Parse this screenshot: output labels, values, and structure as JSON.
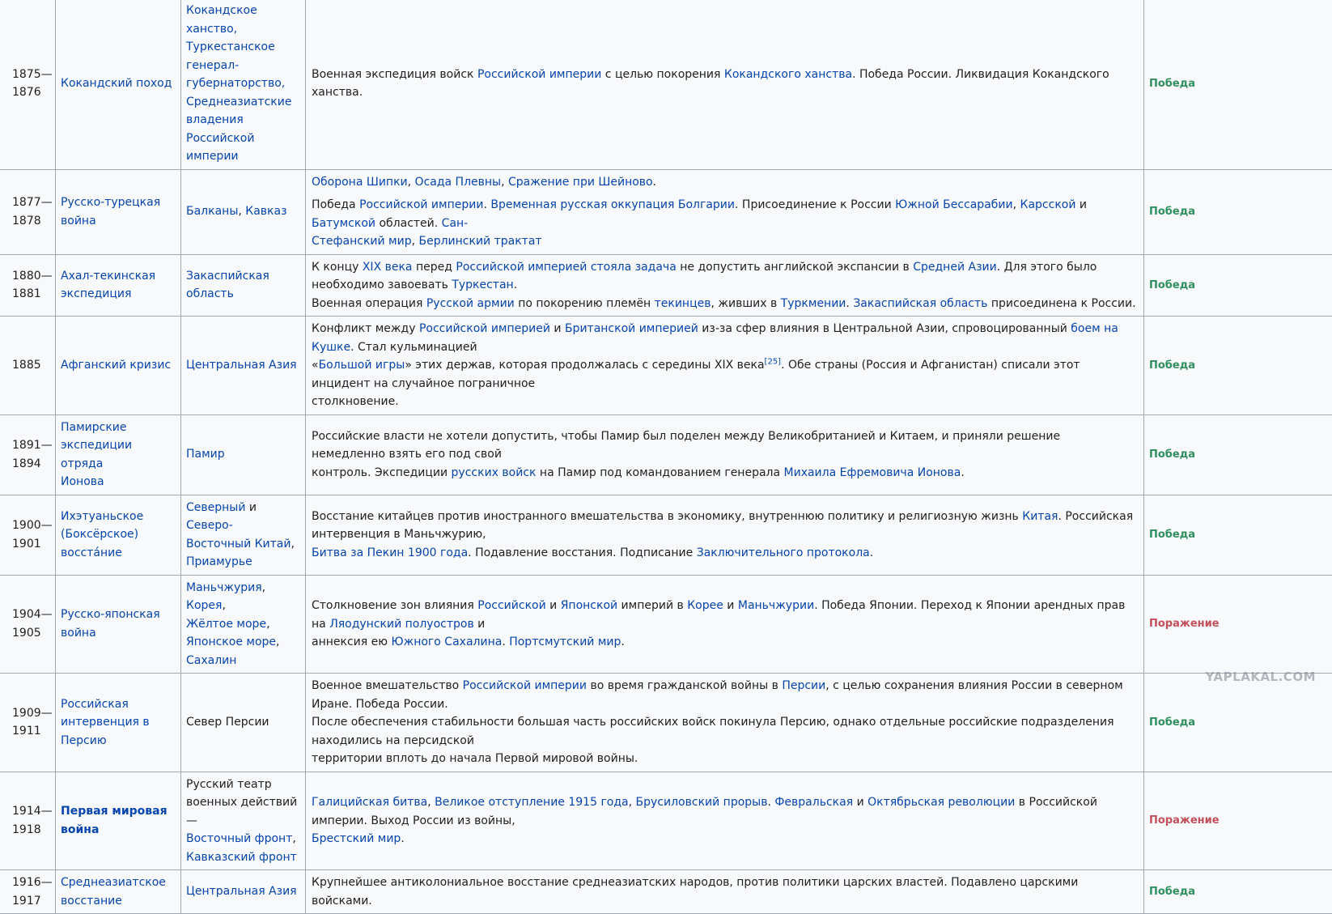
{
  "rows": [
    {
      "years": [
        "1875—",
        "1876"
      ],
      "name": [
        {
          "t": "Кокандский поход",
          "l": true
        }
      ],
      "place": [
        [
          {
            "t": "Кокандское ханство,",
            "l": true
          }
        ],
        [
          {
            "t": "Туркестанское",
            "l": true
          }
        ],
        [
          {
            "t": "генерал-",
            "l": true
          }
        ],
        [
          {
            "t": "губернаторство,",
            "l": true
          }
        ],
        [
          {
            "t": "Среднеазиатские",
            "l": true
          }
        ],
        [
          {
            "t": "владения ",
            "l": true
          },
          {
            "t": "Российской",
            "l": true
          }
        ],
        [
          {
            "t": "империи",
            "l": true
          }
        ]
      ],
      "desc": [
        [
          {
            "t": "Военная экспедиция войск "
          },
          {
            "t": "Российской империи",
            "l": true
          },
          {
            "t": " с целью покорения "
          },
          {
            "t": "Кокандского ханства",
            "l": true
          },
          {
            "t": ". Победа России. Ликвидация Кокандского ханства."
          }
        ]
      ],
      "result": "Победа",
      "res_type": "victory"
    },
    {
      "years": [
        "1877—",
        "1878"
      ],
      "name": [
        {
          "t": "Русско-турецкая война",
          "l": true
        }
      ],
      "place": [
        [
          {
            "t": "Балканы",
            "l": true
          },
          {
            "t": ", "
          },
          {
            "t": "Кавказ",
            "l": true
          }
        ]
      ],
      "desc": [
        [
          {
            "t": "Оборона Шипки",
            "l": true
          },
          {
            "t": ", "
          },
          {
            "t": "Осада Плевны",
            "l": true
          },
          {
            "t": ", "
          },
          {
            "t": "Сражение при Шейново",
            "l": true
          },
          {
            "t": "."
          }
        ],
        [],
        [
          {
            "t": "Победа "
          },
          {
            "t": "Российской империи",
            "l": true
          },
          {
            "t": ". "
          },
          {
            "t": "Временная русская оккупация Болгарии",
            "l": true
          },
          {
            "t": ". Присоединение к России "
          },
          {
            "t": "Южной Бессарабии",
            "l": true
          },
          {
            "t": ", "
          },
          {
            "t": "Карсской",
            "l": true
          },
          {
            "t": " и "
          },
          {
            "t": "Батумской",
            "l": true
          },
          {
            "t": " областей. "
          },
          {
            "t": "Сан-",
            "l": true
          }
        ],
        [
          {
            "t": "Стефанский мир",
            "l": true
          },
          {
            "t": ", "
          },
          {
            "t": "Берлинский трактат",
            "l": true
          }
        ]
      ],
      "result": "Победа",
      "res_type": "victory"
    },
    {
      "years": [
        "1880—",
        "1881"
      ],
      "name": [
        {
          "t": "Ахал-текинская",
          "l": true
        },
        {
          "t": "экспедиция",
          "l": true
        }
      ],
      "place": [
        [
          {
            "t": "Закаспийская область",
            "l": true
          }
        ]
      ],
      "desc": [
        [
          {
            "t": "К концу "
          },
          {
            "t": "XIX века",
            "l": true
          },
          {
            "t": " перед "
          },
          {
            "t": "Российской империей",
            "l": true
          },
          {
            "t": " "
          },
          {
            "t": "стояла задача",
            "l": true
          },
          {
            "t": " не допустить английской экспансии в "
          },
          {
            "t": "Средней Азии",
            "l": true
          },
          {
            "t": ". Для этого было необходимо завоевать "
          },
          {
            "t": "Туркестан",
            "l": true
          },
          {
            "t": "."
          }
        ],
        [
          {
            "t": "Военная операция "
          },
          {
            "t": "Русской армии",
            "l": true
          },
          {
            "t": " по покорению племён "
          },
          {
            "t": "текинцев",
            "l": true
          },
          {
            "t": ", живших в "
          },
          {
            "t": "Туркмении",
            "l": true
          },
          {
            "t": ". "
          },
          {
            "t": "Закаспийская область",
            "l": true
          },
          {
            "t": " присоединена к России."
          }
        ]
      ],
      "result": "Победа",
      "res_type": "victory"
    },
    {
      "years": [
        "1885"
      ],
      "name": [
        {
          "t": "Афганский кризис",
          "l": true
        }
      ],
      "place": [
        [
          {
            "t": "Центральная Азия",
            "l": true
          }
        ]
      ],
      "desc": [
        [
          {
            "t": "Конфликт между "
          },
          {
            "t": "Российской империей",
            "l": true
          },
          {
            "t": " и "
          },
          {
            "t": "Британской империей",
            "l": true
          },
          {
            "t": " из-за сфер влияния в Центральной Азии, спровоцированный "
          },
          {
            "t": "боем на Кушке",
            "l": true
          },
          {
            "t": ". Стал кульминацией"
          }
        ],
        [
          {
            "t": "«"
          },
          {
            "t": "Большой игры",
            "l": true
          },
          {
            "t": "» этих держав, которая продолжалась с середины XIX века"
          },
          {
            "t": "[25]",
            "l": true,
            "s": true
          },
          {
            "t": ". Обе страны (Россия и Афганистан) списали этот инцидент на случайное пограничное"
          }
        ],
        [
          {
            "t": "столкновение."
          }
        ]
      ],
      "result": "Победа",
      "res_type": "victory"
    },
    {
      "years": [
        "1891—",
        "1894"
      ],
      "name": [
        {
          "t": "Памирские",
          "l": true
        },
        {
          "t": "экспедиции отряда",
          "l": true
        },
        {
          "t": "Ионова",
          "l": true
        }
      ],
      "place": [
        [
          {
            "t": "Памир",
            "l": true
          }
        ]
      ],
      "desc": [
        [
          {
            "t": "Российские власти не хотели допустить, чтобы Памир был поделен между Великобританией и Китаем, и приняли решение немедленно взять его под свой"
          }
        ],
        [
          {
            "t": "контроль. Экспедиции "
          },
          {
            "t": "русских войск",
            "l": true
          },
          {
            "t": " на Памир под командованием генерала "
          },
          {
            "t": "Михаила Ефремовича Ионова",
            "l": true
          },
          {
            "t": "."
          }
        ]
      ],
      "result": "Победа",
      "res_type": "victory"
    },
    {
      "years": [
        "1900—",
        "1901"
      ],
      "name": [
        {
          "t": "Ихэтуаньское",
          "l": true
        },
        {
          "t": "(Боксёрское)",
          "l": true
        },
        {
          "t": "восста́ние",
          "l": true
        }
      ],
      "place": [
        [
          {
            "t": "Северный",
            "l": true
          },
          {
            "t": " и "
          },
          {
            "t": "Северо-",
            "l": true
          }
        ],
        [
          {
            "t": "Восточный Китай",
            "l": true
          },
          {
            "t": ","
          }
        ],
        [
          {
            "t": "Приамурье",
            "l": true
          }
        ]
      ],
      "desc": [
        [
          {
            "t": "Восстание китайцев против иностранного вмешательства в экономику, внутреннюю политику и религиозную жизнь "
          },
          {
            "t": "Китая",
            "l": true
          },
          {
            "t": ". Российская интервенция в Маньчжурию,"
          }
        ],
        [
          {
            "t": "Битва за Пекин 1900 года",
            "l": true
          },
          {
            "t": ". Подавление восстания. Подписание "
          },
          {
            "t": "Заключительного протокола",
            "l": true
          },
          {
            "t": "."
          }
        ]
      ],
      "result": "Победа",
      "res_type": "victory"
    },
    {
      "years": [
        "1904—",
        "1905"
      ],
      "name": [
        {
          "t": "Русско-японская",
          "l": true
        },
        {
          "t": "война",
          "l": true
        }
      ],
      "place": [
        [
          {
            "t": "Маньчжурия",
            "l": true
          },
          {
            "t": ", "
          },
          {
            "t": "Корея",
            "l": true
          },
          {
            "t": ","
          }
        ],
        [
          {
            "t": "Жёлтое море",
            "l": true
          },
          {
            "t": ","
          }
        ],
        [
          {
            "t": "Японское море",
            "l": true
          },
          {
            "t": ","
          }
        ],
        [
          {
            "t": "Сахалин",
            "l": true
          }
        ]
      ],
      "desc": [
        [
          {
            "t": "Столкновение зон влияния "
          },
          {
            "t": "Российской",
            "l": true
          },
          {
            "t": " и "
          },
          {
            "t": "Японской",
            "l": true
          },
          {
            "t": " империй в "
          },
          {
            "t": "Корее",
            "l": true
          },
          {
            "t": " и "
          },
          {
            "t": "Маньчжурии",
            "l": true
          },
          {
            "t": ". Победа Японии. Переход к Японии арендных прав на "
          },
          {
            "t": "Ляодунский полуостров",
            "l": true
          },
          {
            "t": " и"
          }
        ],
        [
          {
            "t": "аннексия ею "
          },
          {
            "t": "Южного Сахалина",
            "l": true
          },
          {
            "t": ". "
          },
          {
            "t": "Портсмутский мир",
            "l": true
          },
          {
            "t": "."
          }
        ]
      ],
      "result": "Поражение",
      "res_type": "defeat"
    },
    {
      "years": [
        "1909—",
        "1911"
      ],
      "name": [
        {
          "t": "Российская",
          "l": true
        },
        {
          "t": "интервенция в Персию",
          "l": true
        }
      ],
      "place": [
        [
          {
            "t": "Север Персии"
          }
        ]
      ],
      "desc": [
        [
          {
            "t": "Военное вмешательство "
          },
          {
            "t": "Российской империи",
            "l": true
          },
          {
            "t": " во время гражданской войны в "
          },
          {
            "t": "Персии",
            "l": true
          },
          {
            "t": ", с целью сохранения влияния России в северном Иране. Победа России."
          }
        ],
        [
          {
            "t": "После обеспечения стабильности большая часть российских войск покинула Персию, однако отдельные российские подразделения находились на персидской"
          }
        ],
        [
          {
            "t": "территории вплоть до начала Первой мировой войны."
          }
        ]
      ],
      "result": "Победа",
      "res_type": "victory"
    },
    {
      "years": [
        "1914—",
        "1918"
      ],
      "name": [
        {
          "t": "Первая мировая",
          "l": true,
          "b": true
        },
        {
          "t": "война",
          "l": true,
          "b": true
        }
      ],
      "place": [
        [
          {
            "t": "Русский театр"
          }
        ],
        [
          {
            "t": "военных действий —"
          }
        ],
        [
          {
            "t": "Восточный фронт",
            "l": true
          },
          {
            "t": ","
          }
        ],
        [
          {
            "t": "Кавказский фронт",
            "l": true
          }
        ]
      ],
      "desc": [
        [
          {
            "t": "Галицийская битва",
            "l": true
          },
          {
            "t": ", "
          },
          {
            "t": "Великое отступление 1915 года",
            "l": true
          },
          {
            "t": ", "
          },
          {
            "t": "Брусиловский прорыв",
            "l": true
          },
          {
            "t": ". "
          },
          {
            "t": "Февральская",
            "l": true
          },
          {
            "t": " и "
          },
          {
            "t": "Октябрьская революции",
            "l": true
          },
          {
            "t": " в Российской империи. Выход России из войны,"
          }
        ],
        [
          {
            "t": "Брестский мир",
            "l": true
          },
          {
            "t": "."
          }
        ]
      ],
      "result": "Поражение",
      "res_type": "defeat"
    },
    {
      "years": [
        "1916—",
        "1917"
      ],
      "name": [
        {
          "t": "Среднеазиатское",
          "l": true
        },
        {
          "t": "восстание",
          "l": true
        }
      ],
      "place": [
        [
          {
            "t": "Центральная Азия",
            "l": true
          }
        ]
      ],
      "desc": [
        [
          {
            "t": "Крупнейшее антиколониальное восстание среднеазиатских народов, против политики царских властей. Подавлено царскими войсками."
          }
        ]
      ],
      "result": "Победа",
      "res_type": "victory"
    }
  ],
  "watermark": "YAPLAKAL.COM"
}
